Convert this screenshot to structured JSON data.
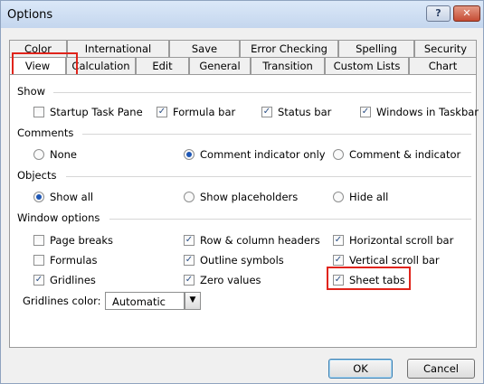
{
  "window": {
    "title": "Options",
    "help": "?",
    "close": "✕"
  },
  "tabs_row1": [
    "Color",
    "International",
    "Save",
    "Error Checking",
    "Spelling",
    "Security"
  ],
  "tabs_row2": [
    "View",
    "Calculation",
    "Edit",
    "General",
    "Transition",
    "Custom Lists",
    "Chart"
  ],
  "show": {
    "heading": "Show",
    "startup": "Startup Task Pane",
    "formula": "Formula bar",
    "status": "Status bar",
    "windows": "Windows in Taskbar",
    "state": {
      "startup": false,
      "formula": true,
      "status": true,
      "windows": true
    }
  },
  "comments": {
    "heading": "Comments",
    "none": "None",
    "indicator": "Comment indicator only",
    "both": "Comment & indicator",
    "selected": "indicator"
  },
  "objects": {
    "heading": "Objects",
    "all": "Show all",
    "placeholders": "Show placeholders",
    "hide": "Hide all",
    "selected": "all"
  },
  "window_options": {
    "heading": "Window options",
    "page_breaks": "Page breaks",
    "formulas": "Formulas",
    "gridlines": "Gridlines",
    "headers": "Row & column headers",
    "outline": "Outline symbols",
    "zero": "Zero values",
    "hscroll": "Horizontal scroll bar",
    "vscroll": "Vertical scroll bar",
    "sheet_tabs": "Sheet tabs",
    "state": {
      "page_breaks": false,
      "formulas": false,
      "gridlines": true,
      "headers": true,
      "outline": true,
      "zero": true,
      "hscroll": true,
      "vscroll": true,
      "sheet_tabs": true
    }
  },
  "gridlines_color": {
    "label": "Gridlines color:",
    "value": "Automatic"
  },
  "buttons": {
    "ok": "OK",
    "cancel": "Cancel"
  },
  "colors": {
    "highlight": "#e0241b",
    "check": "#2a4f86"
  }
}
